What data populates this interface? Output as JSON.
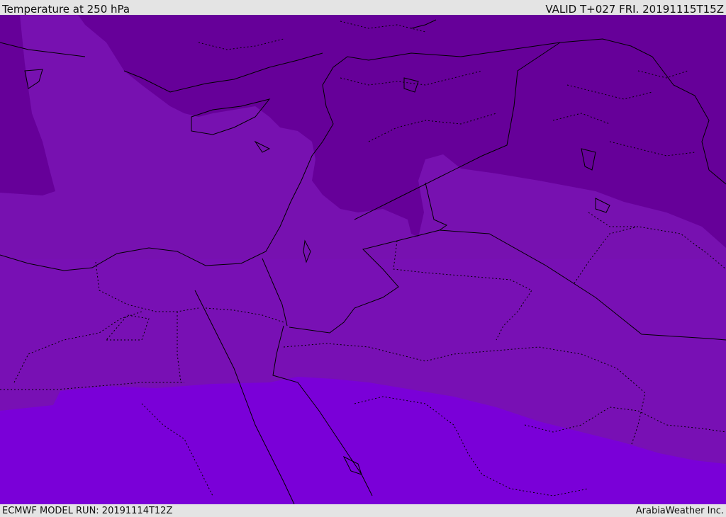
{
  "header": {
    "title": "Temperature at 250 hPa",
    "valid_time": "VALID T+027 FRI. 20191115T15Z"
  },
  "footer": {
    "model_run": "ECMWF MODEL RUN: 20191114T12Z",
    "credit": "ArabiaWeather Inc."
  },
  "map": {
    "colors": {
      "coldest": "#660099",
      "cold": "#7711b0",
      "mid": "#7a11b8",
      "warm": "#7a00d8",
      "borders": "#000000"
    }
  }
}
